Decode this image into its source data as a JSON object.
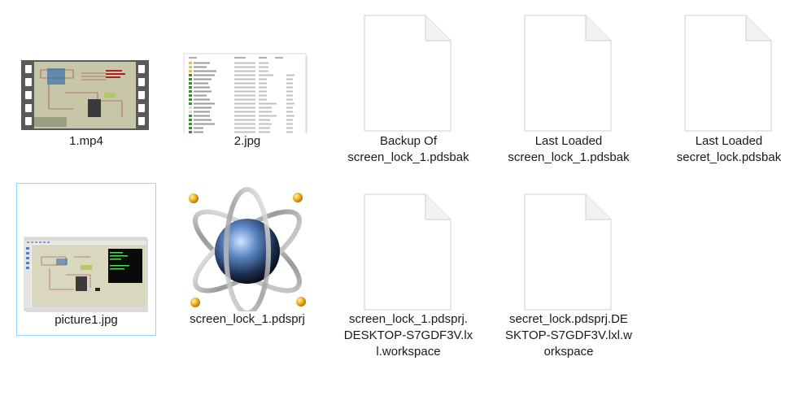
{
  "files": [
    {
      "name": "1.mp4",
      "type": "video"
    },
    {
      "name": "2.jpg",
      "type": "image-explorer-screenshot"
    },
    {
      "name": "Backup Of\nscreen_lock_1.pdsbak",
      "type": "document"
    },
    {
      "name": "Last Loaded\nscreen_lock_1.pdsbak",
      "type": "document"
    },
    {
      "name": "Last Loaded\nsecret_lock.pdsbak",
      "type": "document"
    },
    {
      "name": "picture1.jpg",
      "type": "image-proteus-screenshot",
      "selected": true
    },
    {
      "name": "screen_lock_1.pdsprj",
      "type": "proteus-project"
    },
    {
      "name": "screen_lock_1.pdsprj.\nDESKTOP-S7GDF3V.lx\nl.workspace",
      "type": "document"
    },
    {
      "name": "secret_lock.pdsprj.DE\nSKTOP-S7GDF3V.lxl.w\norkspace",
      "type": "document"
    }
  ],
  "colors": {
    "selection_border": "#99d1ff",
    "text": "#1a1a1a"
  }
}
